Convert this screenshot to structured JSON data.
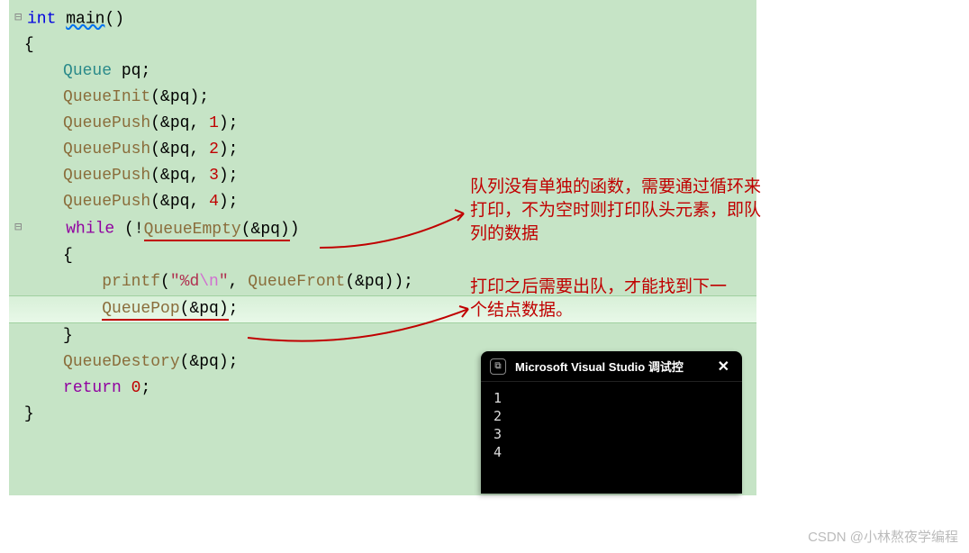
{
  "code": {
    "funcDecl": {
      "type": "int",
      "name": "main"
    },
    "queueType": "Queue",
    "queueVar": "pq",
    "init": "QueueInit",
    "push": "QueuePush",
    "pushArgs": [
      "1",
      "2",
      "3",
      "4"
    ],
    "whileKw": "while",
    "empty": "QueueEmpty",
    "printf": "printf",
    "fmt_open": "\"%d",
    "fmt_esc": "\\n",
    "fmt_close": "\"",
    "front": "QueueFront",
    "pop": "QueuePop",
    "destroy": "QueueDestory",
    "returnKw": "return",
    "returnVal": "0",
    "amp_param": "&pq"
  },
  "annotations": {
    "a1": "队列没有单独的函数，需要通过循环来打印，不为空时则打印队头元素，即队列的数据",
    "a2": "打印之后需要出队，才能找到下一个结点数据。"
  },
  "terminal": {
    "title": "Microsoft Visual Studio 调试控",
    "output": [
      "1",
      "2",
      "3",
      "4"
    ]
  },
  "watermark": "CSDN @小林熬夜学编程"
}
